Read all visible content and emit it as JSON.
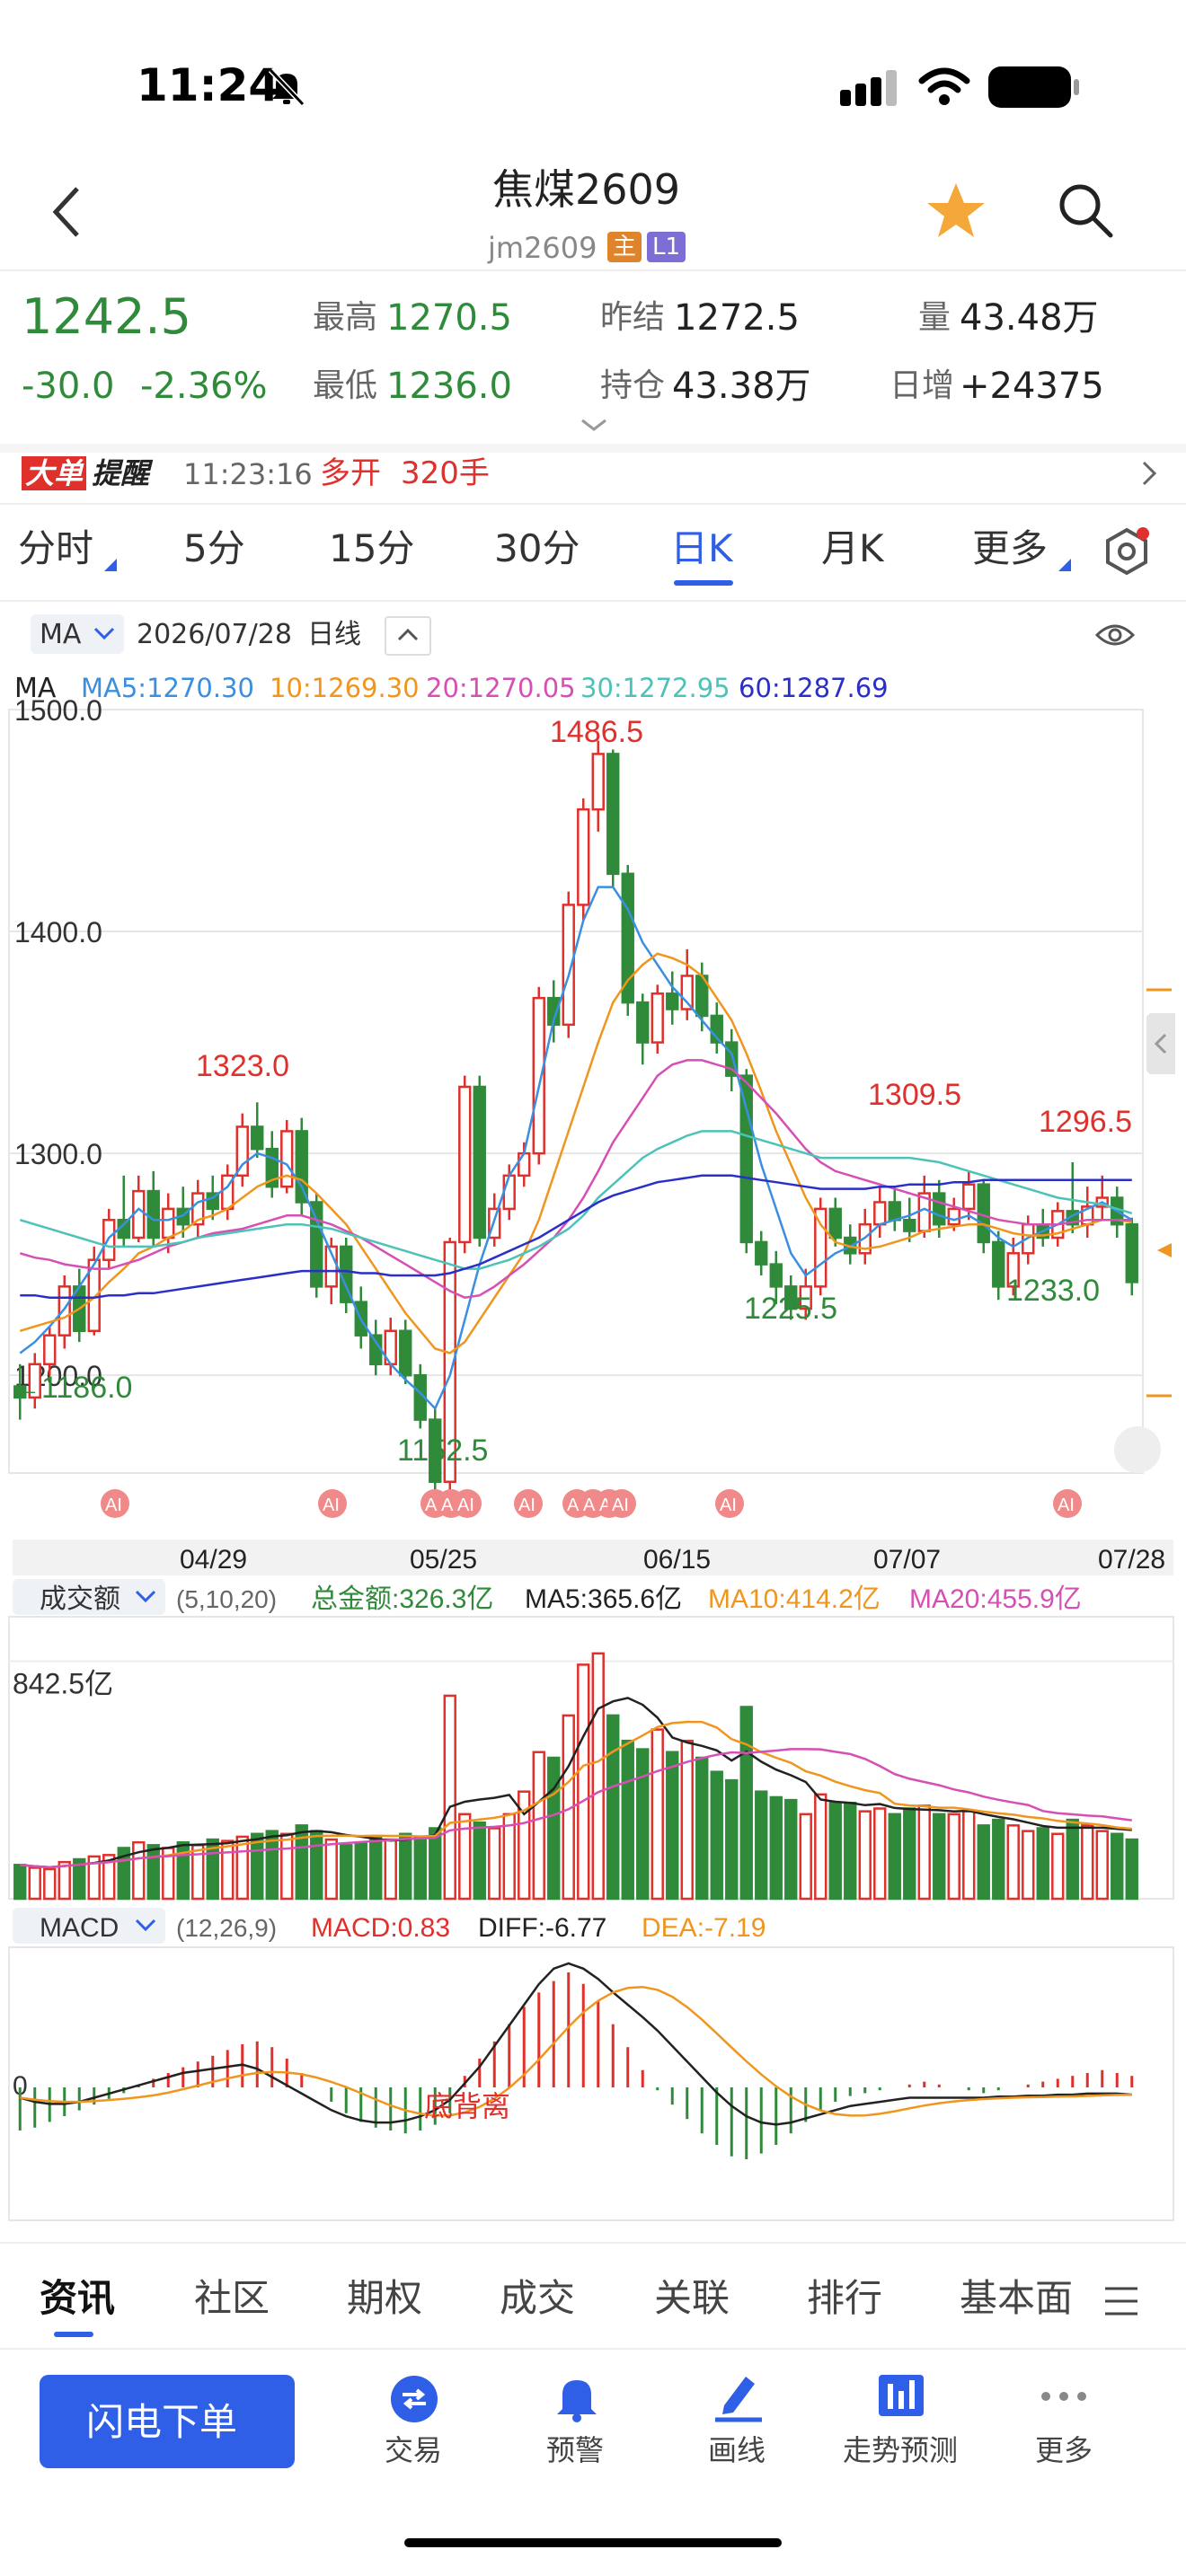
{
  "status_bar": {
    "time": "11:24"
  },
  "header": {
    "title": "焦煤2609",
    "subtitle": "jm2609",
    "badge_main": "主",
    "badge_l1": "L1"
  },
  "quote": {
    "price": "1242.5",
    "change": "-30.0",
    "change_pct": "-2.36%",
    "high_label": "最高",
    "high": "1270.5",
    "low_label": "最低",
    "low": "1236.0",
    "prev_settle_label": "昨结",
    "prev_settle": "1272.5",
    "open_interest_label": "持仓",
    "open_interest": "43.38万",
    "volume_label": "量",
    "volume": "43.48万",
    "daily_inc_label": "日增",
    "daily_inc": "+24375"
  },
  "alert": {
    "badge_a": "大单",
    "badge_b": "提醒",
    "time": "11:23:16",
    "action": "多开",
    "lots": "320手"
  },
  "period_tabs": [
    {
      "label": "分时"
    },
    {
      "label": "5分"
    },
    {
      "label": "15分"
    },
    {
      "label": "30分"
    },
    {
      "label": "日K"
    },
    {
      "label": "月K"
    },
    {
      "label": "更多"
    }
  ],
  "chart_toolbar": {
    "indicator": "MA",
    "date": "2026/07/28",
    "period": "日线"
  },
  "ma_legend": {
    "label": "MA",
    "ma5": "MA5:1270.30",
    "ma10": "10:1269.30",
    "ma20": "20:1270.05",
    "ma30": "30:1272.95",
    "ma60": "60:1287.69"
  },
  "colors": {
    "up": "#e0302c",
    "down": "#2f8a3a",
    "ma5": "#3a8fe0",
    "ma10": "#f0961e",
    "ma20": "#d64fb4",
    "ma30": "#4cc2b8",
    "ma60": "#2a2fc8",
    "accent": "#2f5fe6"
  },
  "chart_data": {
    "type": "candlestick",
    "y_ticks": [
      "1500.0",
      "1400.0",
      "1300.0",
      "1200.0"
    ],
    "ylim": [
      1160,
      1500
    ],
    "x_labels": [
      "04/29",
      "05/25",
      "06/15",
      "07/07",
      "07/28"
    ],
    "annotations": [
      "1486.5",
      "1323.0",
      "1309.5",
      "1296.5",
      "1225.5",
      "1233.0",
      "1152.5",
      "←1186.0"
    ],
    "ai_tag": "AI",
    "candles": [
      [
        1195,
        1190,
        1205,
        1180
      ],
      [
        1190,
        1205,
        1210,
        1185
      ],
      [
        1205,
        1218,
        1222,
        1200
      ],
      [
        1218,
        1240,
        1245,
        1212
      ],
      [
        1240,
        1220,
        1248,
        1215
      ],
      [
        1220,
        1252,
        1258,
        1218
      ],
      [
        1252,
        1270,
        1275,
        1248
      ],
      [
        1270,
        1262,
        1290,
        1258
      ],
      [
        1262,
        1283,
        1290,
        1260
      ],
      [
        1283,
        1262,
        1292,
        1258
      ],
      [
        1262,
        1275,
        1282,
        1255
      ],
      [
        1275,
        1268,
        1285,
        1262
      ],
      [
        1268,
        1282,
        1288,
        1262
      ],
      [
        1282,
        1275,
        1290,
        1270
      ],
      [
        1275,
        1290,
        1295,
        1270
      ],
      [
        1290,
        1312,
        1318,
        1285
      ],
      [
        1312,
        1302,
        1323,
        1298
      ],
      [
        1302,
        1285,
        1310,
        1280
      ],
      [
        1285,
        1310,
        1315,
        1282
      ],
      [
        1310,
        1278,
        1316,
        1272
      ],
      [
        1278,
        1240,
        1282,
        1235
      ],
      [
        1240,
        1258,
        1262,
        1232
      ],
      [
        1258,
        1233,
        1262,
        1228
      ],
      [
        1233,
        1218,
        1240,
        1212
      ],
      [
        1218,
        1205,
        1225,
        1200
      ],
      [
        1205,
        1220,
        1226,
        1200
      ],
      [
        1220,
        1200,
        1225,
        1196
      ],
      [
        1200,
        1180,
        1205,
        1176
      ],
      [
        1180,
        1152,
        1186,
        1148
      ],
      [
        1152,
        1260,
        1262,
        1148
      ],
      [
        1260,
        1330,
        1335,
        1255
      ],
      [
        1330,
        1262,
        1335,
        1258
      ],
      [
        1262,
        1275,
        1282,
        1258
      ],
      [
        1275,
        1290,
        1295,
        1270
      ],
      [
        1290,
        1300,
        1305,
        1285
      ],
      [
        1300,
        1370,
        1375,
        1295
      ],
      [
        1370,
        1358,
        1378,
        1350
      ],
      [
        1358,
        1412,
        1418,
        1352
      ],
      [
        1412,
        1455,
        1460,
        1405
      ],
      [
        1455,
        1480,
        1486,
        1445
      ],
      [
        1480,
        1426,
        1482,
        1420
      ],
      [
        1426,
        1368,
        1430,
        1362
      ],
      [
        1368,
        1350,
        1372,
        1340
      ],
      [
        1350,
        1372,
        1376,
        1345
      ],
      [
        1372,
        1365,
        1382,
        1358
      ],
      [
        1365,
        1380,
        1392,
        1360
      ],
      [
        1380,
        1362,
        1386,
        1355
      ],
      [
        1362,
        1350,
        1368,
        1345
      ],
      [
        1350,
        1335,
        1356,
        1328
      ],
      [
        1335,
        1260,
        1338,
        1255
      ],
      [
        1260,
        1250,
        1265,
        1245
      ],
      [
        1250,
        1240,
        1256,
        1232
      ],
      [
        1240,
        1230,
        1245,
        1225
      ],
      [
        1230,
        1240,
        1248,
        1225
      ],
      [
        1240,
        1275,
        1280,
        1236
      ],
      [
        1275,
        1262,
        1280,
        1258
      ],
      [
        1262,
        1255,
        1268,
        1250
      ],
      [
        1255,
        1268,
        1275,
        1250
      ],
      [
        1268,
        1278,
        1285,
        1262
      ],
      [
        1278,
        1270,
        1285,
        1265
      ],
      [
        1270,
        1265,
        1280,
        1260
      ],
      [
        1265,
        1282,
        1290,
        1262
      ],
      [
        1282,
        1268,
        1288,
        1262
      ],
      [
        1268,
        1275,
        1280,
        1265
      ],
      [
        1275,
        1286,
        1292,
        1270
      ],
      [
        1286,
        1260,
        1288,
        1255
      ],
      [
        1260,
        1240,
        1265,
        1234
      ],
      [
        1240,
        1255,
        1262,
        1236
      ],
      [
        1255,
        1268,
        1272,
        1250
      ],
      [
        1268,
        1262,
        1275,
        1258
      ],
      [
        1262,
        1274,
        1278,
        1258
      ],
      [
        1274,
        1268,
        1296,
        1264
      ],
      [
        1268,
        1276,
        1285,
        1262
      ],
      [
        1276,
        1280,
        1290,
        1270
      ],
      [
        1280,
        1268,
        1285,
        1262
      ],
      [
        1268,
        1242,
        1271,
        1236
      ]
    ],
    "ma_series": [
      {
        "name": "MA5",
        "values": [
          1210,
          1215,
          1222,
          1230,
          1240,
          1250,
          1262,
          1268,
          1275,
          1270,
          1270,
          1272,
          1278,
          1280,
          1285,
          1295,
          1300,
          1298,
          1295,
          1285,
          1270,
          1255,
          1240,
          1225,
          1215,
          1205,
          1198,
          1192,
          1185,
          1200,
          1225,
          1250,
          1270,
          1290,
          1300,
          1330,
          1360,
          1380,
          1405,
          1420,
          1420,
          1410,
          1395,
          1385,
          1375,
          1368,
          1360,
          1352,
          1345,
          1320,
          1295,
          1275,
          1255,
          1245,
          1250,
          1255,
          1258,
          1262,
          1268,
          1270,
          1272,
          1275,
          1272,
          1270,
          1272,
          1268,
          1262,
          1258,
          1262,
          1265,
          1268,
          1272,
          1275,
          1278,
          1274,
          1270
        ]
      },
      {
        "name": "MA10",
        "values": [
          1220,
          1222,
          1224,
          1226,
          1230,
          1235,
          1242,
          1248,
          1255,
          1258,
          1262,
          1265,
          1270,
          1272,
          1275,
          1280,
          1285,
          1288,
          1290,
          1288,
          1282,
          1275,
          1268,
          1258,
          1248,
          1238,
          1228,
          1220,
          1212,
          1210,
          1215,
          1225,
          1235,
          1245,
          1255,
          1270,
          1290,
          1310,
          1330,
          1350,
          1368,
          1378,
          1385,
          1390,
          1388,
          1385,
          1380,
          1370,
          1360,
          1345,
          1328,
          1310,
          1295,
          1280,
          1268,
          1260,
          1258,
          1257,
          1258,
          1260,
          1262,
          1265,
          1266,
          1267,
          1268,
          1268,
          1266,
          1264,
          1263,
          1263,
          1264,
          1266,
          1268,
          1270,
          1270,
          1269
        ]
      },
      {
        "name": "MA20",
        "values": [
          1255,
          1253,
          1252,
          1250,
          1249,
          1248,
          1248,
          1250,
          1252,
          1255,
          1258,
          1260,
          1262,
          1264,
          1265,
          1266,
          1268,
          1270,
          1272,
          1272,
          1270,
          1268,
          1265,
          1262,
          1258,
          1254,
          1250,
          1246,
          1242,
          1238,
          1235,
          1236,
          1240,
          1245,
          1250,
          1256,
          1262,
          1270,
          1280,
          1292,
          1305,
          1315,
          1325,
          1335,
          1340,
          1342,
          1342,
          1340,
          1338,
          1332,
          1325,
          1318,
          1310,
          1302,
          1296,
          1292,
          1290,
          1288,
          1286,
          1284,
          1282,
          1280,
          1278,
          1276,
          1274,
          1272,
          1270,
          1269,
          1268,
          1268,
          1268,
          1269,
          1270,
          1270,
          1270,
          1270
        ]
      },
      {
        "name": "MA30",
        "values": [
          1270,
          1268,
          1266,
          1264,
          1262,
          1260,
          1258,
          1258,
          1258,
          1258,
          1259,
          1260,
          1262,
          1263,
          1264,
          1265,
          1266,
          1267,
          1268,
          1268,
          1267,
          1266,
          1264,
          1262,
          1260,
          1258,
          1256,
          1254,
          1252,
          1250,
          1248,
          1248,
          1250,
          1252,
          1255,
          1258,
          1262,
          1266,
          1272,
          1280,
          1286,
          1292,
          1298,
          1302,
          1305,
          1308,
          1310,
          1310,
          1310,
          1308,
          1306,
          1304,
          1302,
          1300,
          1298,
          1298,
          1298,
          1298,
          1298,
          1298,
          1298,
          1297,
          1296,
          1294,
          1292,
          1290,
          1288,
          1286,
          1284,
          1282,
          1280,
          1279,
          1278,
          1277,
          1275,
          1273
        ]
      },
      {
        "name": "MA60",
        "values": [
          1236,
          1236,
          1235,
          1235,
          1235,
          1235,
          1236,
          1236,
          1237,
          1237,
          1238,
          1239,
          1240,
          1241,
          1242,
          1243,
          1244,
          1245,
          1246,
          1247,
          1247,
          1247,
          1247,
          1246,
          1246,
          1245,
          1245,
          1245,
          1245,
          1246,
          1248,
          1250,
          1253,
          1256,
          1259,
          1262,
          1266,
          1270,
          1274,
          1278,
          1281,
          1283,
          1285,
          1287,
          1288,
          1289,
          1290,
          1290,
          1290,
          1289,
          1288,
          1287,
          1286,
          1285,
          1284,
          1284,
          1284,
          1284,
          1285,
          1285,
          1286,
          1286,
          1286,
          1287,
          1287,
          1288,
          1288,
          1288,
          1288,
          1288,
          1288,
          1288,
          1288,
          1288,
          1288,
          1288
        ]
      }
    ],
    "volume": {
      "label": "成交额",
      "params": "(5,10,20)",
      "total": "总金额:326.3亿",
      "ma5": "MA5:365.6亿",
      "ma10": "MA10:414.2亿",
      "ma20": "MA20:455.9亿",
      "tick": "842.5亿",
      "max": 1000,
      "values": [
        120,
        110,
        105,
        130,
        140,
        150,
        155,
        180,
        200,
        190,
        180,
        200,
        190,
        210,
        205,
        220,
        230,
        240,
        230,
        260,
        240,
        210,
        190,
        200,
        220,
        210,
        230,
        220,
        250,
        720,
        300,
        270,
        250,
        300,
        380,
        520,
        500,
        650,
        830,
        870,
        650,
        560,
        530,
        600,
        520,
        560,
        500,
        450,
        420,
        680,
        380,
        360,
        350,
        300,
        370,
        340,
        340,
        310,
        320,
        300,
        320,
        330,
        300,
        300,
        310,
        260,
        280,
        260,
        240,
        250,
        230,
        280,
        260,
        240,
        230,
        210
      ]
    },
    "macd": {
      "label": "MACD",
      "params": "(12,26,9)",
      "macd": "MACD:0.83",
      "diff": "DIFF:-6.77",
      "dea": "DEA:-7.19",
      "zero_label": "0",
      "annotation": "底背离",
      "hist": [
        -30,
        -28,
        -24,
        -20,
        -16,
        -12,
        -8,
        -4,
        2,
        6,
        10,
        14,
        18,
        22,
        26,
        30,
        32,
        28,
        20,
        10,
        0,
        -10,
        -18,
        -24,
        -28,
        -30,
        -32,
        -30,
        -26,
        -18,
        8,
        20,
        32,
        44,
        56,
        66,
        74,
        80,
        72,
        60,
        44,
        28,
        12,
        -2,
        -12,
        -22,
        -32,
        -40,
        -48,
        -50,
        -46,
        -40,
        -32,
        -24,
        -16,
        -10,
        -6,
        -4,
        -2,
        0,
        2,
        4,
        2,
        0,
        -2,
        -4,
        -2,
        0,
        2,
        4,
        6,
        8,
        10,
        12,
        10,
        8
      ],
      "diff_series": [
        -10,
        -14,
        -16,
        -16,
        -14,
        -10,
        -6,
        -2,
        2,
        6,
        10,
        14,
        16,
        18,
        20,
        22,
        18,
        10,
        2,
        -6,
        -14,
        -22,
        -28,
        -32,
        -34,
        -34,
        -32,
        -28,
        -22,
        -12,
        4,
        20,
        40,
        60,
        80,
        100,
        115,
        120,
        115,
        105,
        92,
        80,
        68,
        55,
        40,
        25,
        10,
        -5,
        -18,
        -28,
        -34,
        -36,
        -34,
        -30,
        -26,
        -22,
        -18,
        -16,
        -14,
        -12,
        -10,
        -10,
        -10,
        -10,
        -10,
        -10,
        -9,
        -9,
        -8,
        -8,
        -7,
        -7,
        -6,
        -6,
        -6,
        -7
      ]
    },
    "dea_series_note": ""
  },
  "bottom_tabs": [
    {
      "label": "资讯"
    },
    {
      "label": "社区"
    },
    {
      "label": "期权"
    },
    {
      "label": "成交"
    },
    {
      "label": "关联"
    },
    {
      "label": "排行"
    },
    {
      "label": "基本面"
    }
  ],
  "bottom_bar": {
    "quick_order": "闪电下单",
    "trade": "交易",
    "alert": "预警",
    "draw": "画线",
    "forecast": "走势预测",
    "more": "更多"
  }
}
